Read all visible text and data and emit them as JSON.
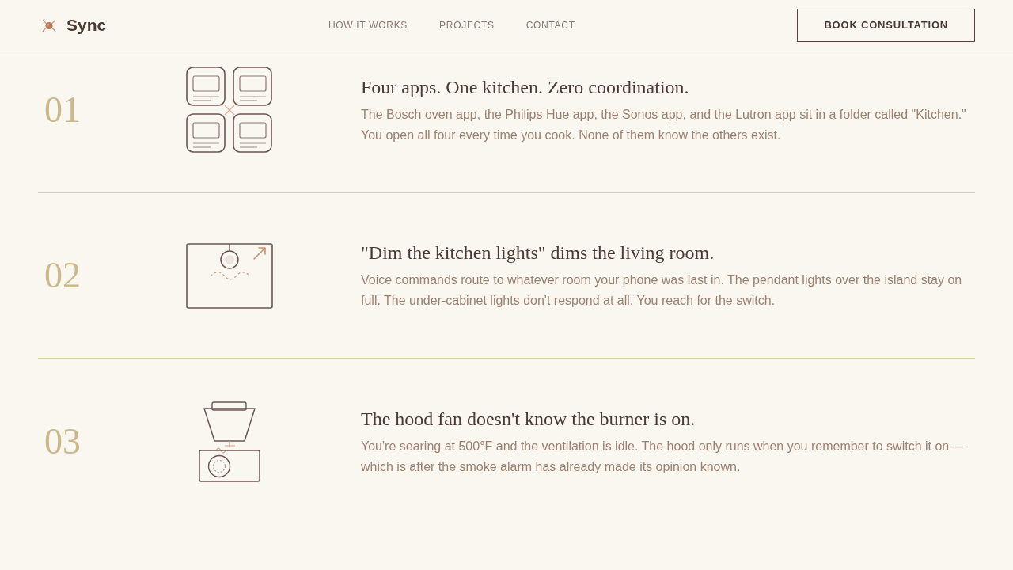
{
  "header": {
    "brand": "Sync",
    "nav": [
      {
        "label": "HOW IT WORKS"
      },
      {
        "label": "PROJECTS"
      },
      {
        "label": "CONTACT"
      }
    ],
    "cta": "BOOK CONSULTATION"
  },
  "problems": [
    {
      "number": "01",
      "kind": "apps",
      "title": "Four apps. One kitchen. Zero coordination.",
      "body": "The Bosch oven app, the Philips Hue app, the Sonos app, and the Lutron app sit in a folder called \"Kitchen.\" You open all four every time you cook. None of them know the others exist."
    },
    {
      "number": "02",
      "kind": "lamp",
      "title": "\"Dim the kitchen lights\" dims the living room.",
      "body": "Voice commands route to whatever room your phone was last in. The pendant lights over the island stay on full. The under-cabinet lights don't respond at all. You reach for the switch."
    },
    {
      "number": "03",
      "kind": "hood",
      "title": "The hood fan doesn't know the burner is on.",
      "body": "You're searing at 500°F and the ventilation is idle. The hood only runs when you remember to switch it on — which is after the smoke alarm has already made its opinion known."
    }
  ]
}
